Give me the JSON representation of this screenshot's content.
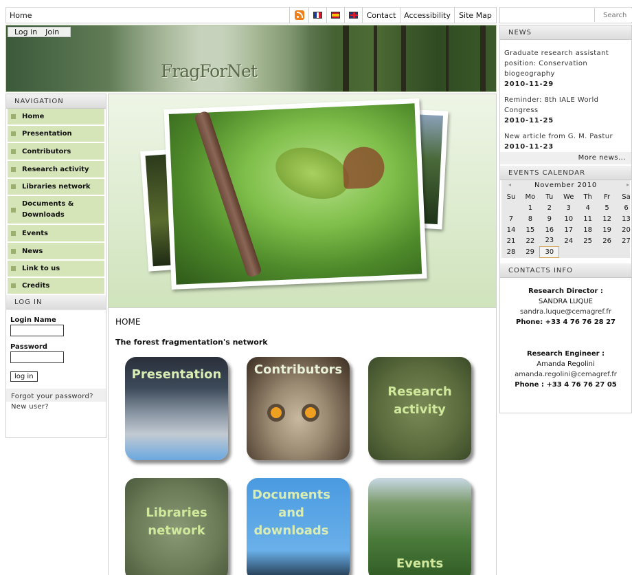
{
  "topbar": {
    "home": "Home",
    "links": [
      "Contact",
      "Accessibility",
      "Site Map"
    ]
  },
  "search": {
    "placeholder": "Search"
  },
  "banner": {
    "logo": "FragForNet",
    "login": "Log in",
    "join": "Join"
  },
  "navigation": {
    "title": "NAVIGATION",
    "items": [
      "Home",
      "Presentation",
      "Contributors",
      "Research activity",
      "Libraries network",
      "Documents & Downloads",
      "Events",
      "News",
      "Link to us",
      "Credits"
    ]
  },
  "login_box": {
    "title": "LOG IN",
    "login_label": "Login Name",
    "password_label": "Password",
    "button": "log in",
    "forgot": "Forgot your password?",
    "new_user": "New user?"
  },
  "main": {
    "breadcrumb": "HOME",
    "tagline": "The forest fragmentation's network",
    "tiles": [
      "Presentation",
      "Contributors",
      "Research activity",
      "Libraries network",
      "Documents and downloads",
      "Events"
    ]
  },
  "news": {
    "title": "NEWS",
    "items": [
      {
        "text": "Graduate research assistant position: Conservation biogeography",
        "date": "2010-11-29"
      },
      {
        "text": "Reminder: 8th IALE World Congress",
        "date": "2010-11-25"
      },
      {
        "text": "New article from G. M. Pastur",
        "date": "2010-11-23"
      }
    ],
    "more": "More news..."
  },
  "calendar": {
    "title": "EVENTS CALENDAR",
    "month": "November 2010",
    "prev": "◂",
    "next": "▸",
    "weekdays": [
      "Su",
      "Mo",
      "Tu",
      "We",
      "Th",
      "Fr",
      "Sa"
    ],
    "weeks": [
      [
        "",
        "1",
        "2",
        "3",
        "4",
        "5",
        "6"
      ],
      [
        "7",
        "8",
        "9",
        "10",
        "11",
        "12",
        "13"
      ],
      [
        "14",
        "15",
        "16",
        "17",
        "18",
        "19",
        "20"
      ],
      [
        "21",
        "22",
        "23",
        "24",
        "25",
        "26",
        "27"
      ],
      [
        "28",
        "29",
        "30",
        "",
        "",
        "",
        ""
      ]
    ],
    "today": "30"
  },
  "contacts": {
    "title": "CONTACTS INFO",
    "people": [
      {
        "role": "Research Director :",
        "name": "SANDRA LUQUE",
        "email": "sandra.luque@cemagref.fr",
        "phone": "Phone: +33 4 76 76 28 27"
      },
      {
        "role": "Research Engineer :",
        "name": "Amanda Regolini",
        "email": "amanda.regolini@cemagref.fr",
        "phone": "Phone : +33 4 76 76 27 05"
      }
    ]
  },
  "colors": {
    "nav_bg": "#d6e5b8",
    "nav_bullet": "#9bb070",
    "rss": "#f07f1a"
  }
}
